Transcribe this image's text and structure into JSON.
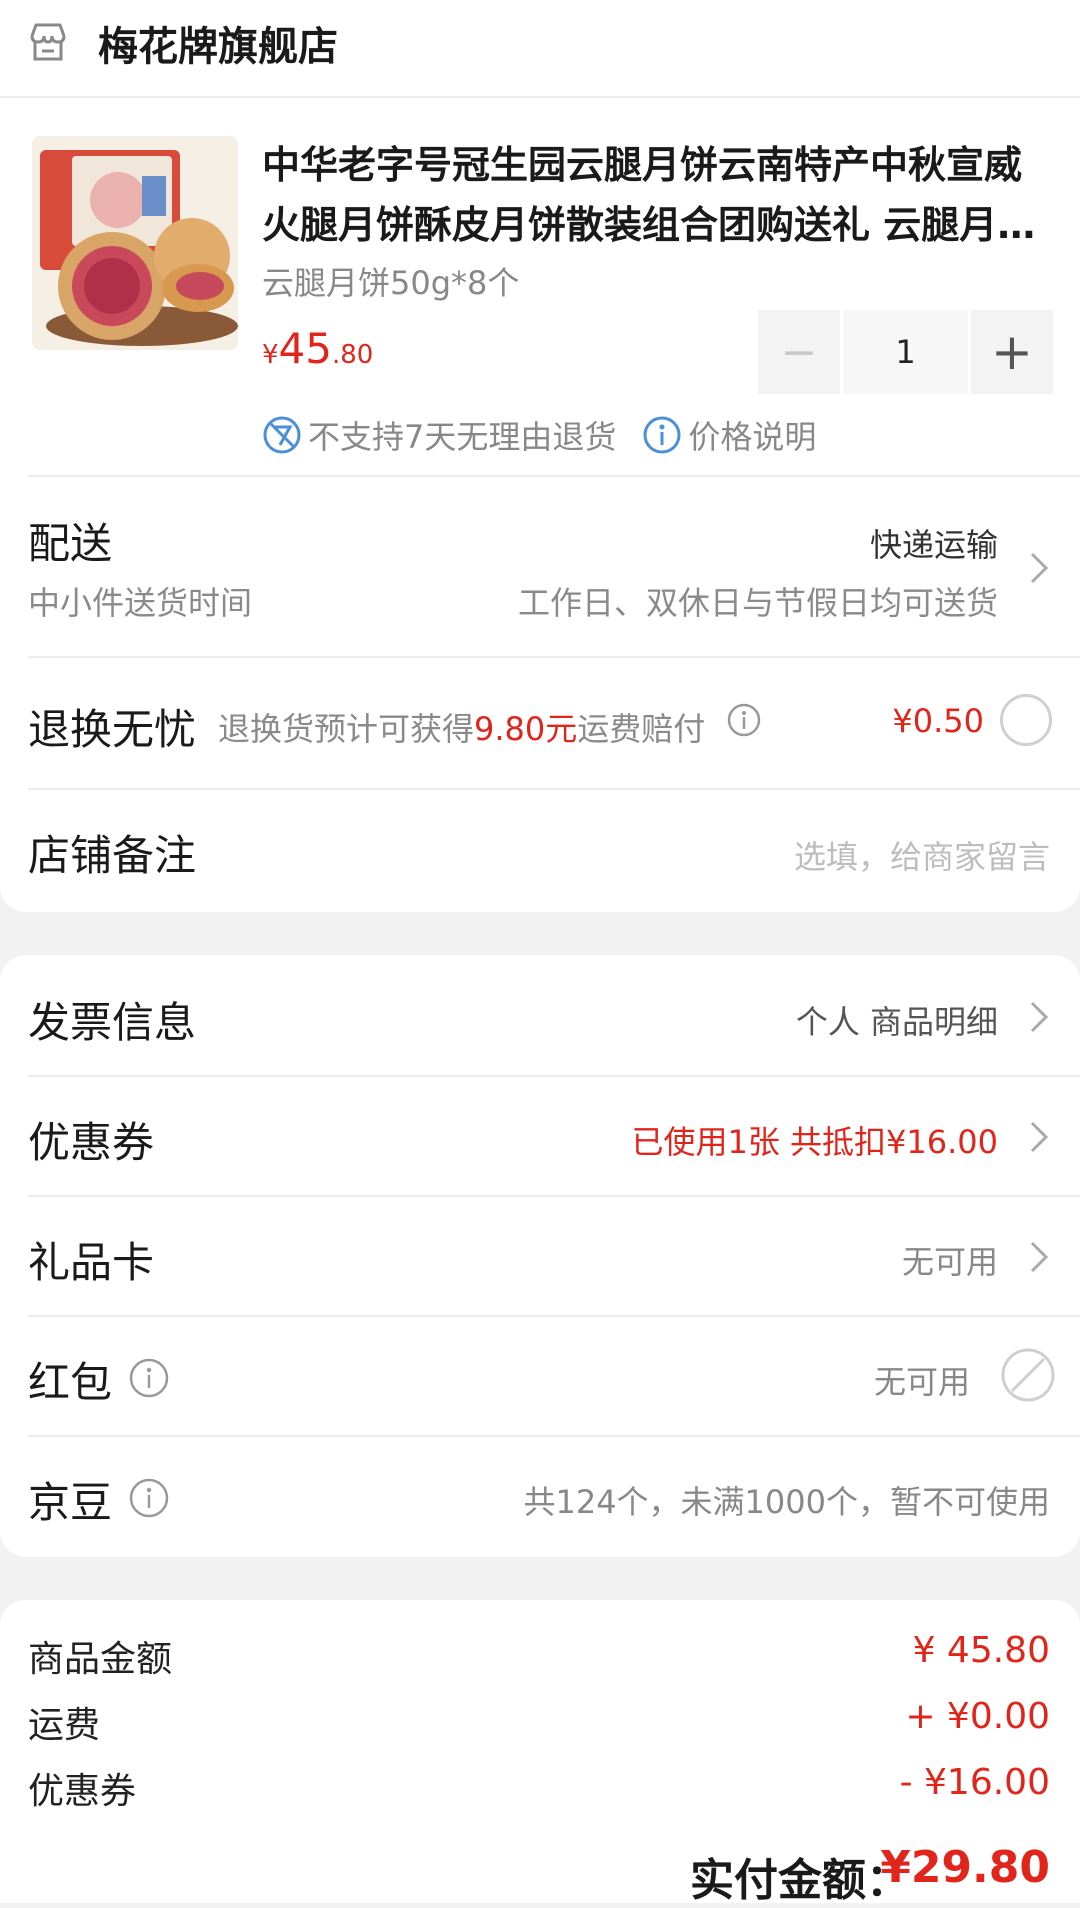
{
  "store": {
    "name": "梅花牌旗舰店",
    "icon": "store-icon"
  },
  "product": {
    "title": "中华老字号冠生园云腿月饼云南特产中秋宣威火腿月饼酥皮月饼散装组合团购送礼 云腿月饼50g*8个",
    "spec": "云腿月饼50g*8个",
    "price_symbol": "¥",
    "price_int": "45",
    "price_dec": ".80",
    "quantity": "1",
    "minus_label": "−",
    "plus_label": "+",
    "tag_no_return": "不支持7天无理由退货",
    "tag_price_info": "价格说明"
  },
  "delivery": {
    "title": "配送",
    "method": "快递运输",
    "subtitle": "中小件送货时间",
    "note": "工作日、双休日与节假日均可送货"
  },
  "return_worry_free": {
    "title": "退换无忧",
    "desc_prefix": "退换货预计可获得",
    "desc_amount": "9.80元",
    "desc_suffix": "运费赔付",
    "price": "¥0.50"
  },
  "store_note": {
    "title": "店铺备注",
    "placeholder": "选填，给商家留言"
  },
  "invoice": {
    "title": "发票信息",
    "value": "个人 商品明细"
  },
  "coupon": {
    "title": "优惠券",
    "value": "已使用1张 共抵扣¥16.00"
  },
  "gift_card": {
    "title": "礼品卡",
    "value": "无可用"
  },
  "red_packet": {
    "title": "红包",
    "value": "无可用"
  },
  "jingdou": {
    "title": "京豆",
    "value": "共124个，未满1000个，暂不可使用"
  },
  "summary": {
    "goods_label": "商品金额",
    "goods_value": "¥ 45.80",
    "shipping_label": "运费",
    "shipping_value": "+ ¥0.00",
    "coupon_label": "优惠券",
    "coupon_value": "- ¥16.00",
    "pay_label": "实付金额：",
    "pay_value": "¥29.80"
  },
  "colors": {
    "accent": "#e1251b",
    "icon_blue": "#4a90d9",
    "background": "#f2f2f2"
  }
}
